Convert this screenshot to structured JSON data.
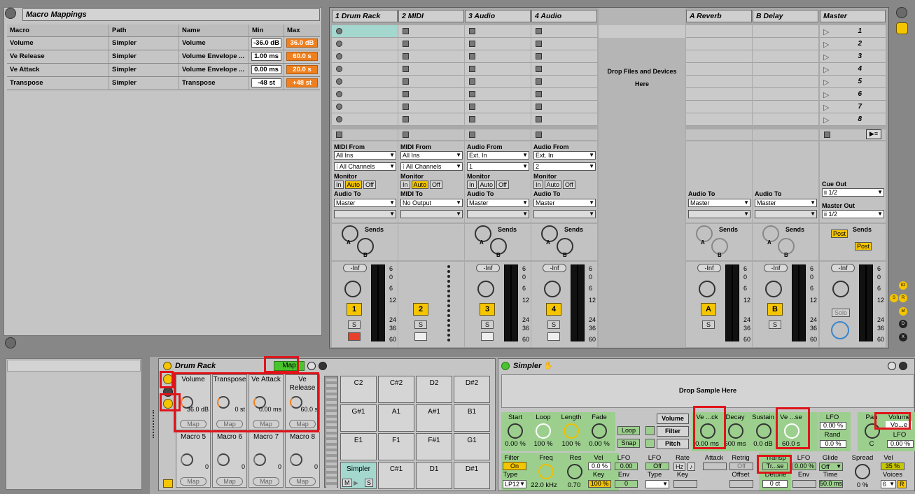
{
  "macro_mappings": {
    "title": "Macro Mappings",
    "columns": [
      "Macro",
      "Path",
      "Name",
      "Min",
      "Max"
    ],
    "rows": [
      {
        "macro": "Volume",
        "path": "Simpler",
        "name": "Volume",
        "min": "-36.0 dB",
        "max": "36.0 dB"
      },
      {
        "macro": "Ve Release",
        "path": "Simpler",
        "name": "Volume Envelope ...",
        "min": "1.00 ms",
        "max": "60.0 s"
      },
      {
        "macro": "Ve Attack",
        "path": "Simpler",
        "name": "Volume Envelope ...",
        "min": "0.00 ms",
        "max": "20.0 s"
      },
      {
        "macro": "Transpose",
        "path": "Simpler",
        "name": "Transpose",
        "min": "-48 st",
        "max": "+48 st"
      }
    ]
  },
  "tracks": [
    {
      "name": "1 Drum Rack",
      "in_label": "MIDI From",
      "in_src": "All Ins",
      "in_ch": "⁝ All Channels",
      "out_label": "Audio To",
      "out": "Master",
      "number": "1"
    },
    {
      "name": "2 MIDI",
      "in_label": "MIDI From",
      "in_src": "All Ins",
      "in_ch": "⁝ All Channels",
      "out_label": "MIDI To",
      "out": "No Output",
      "number": "2"
    },
    {
      "name": "3 Audio",
      "in_label": "Audio From",
      "in_src": "Ext. In",
      "in_ch": "1",
      "out_label": "Audio To",
      "out": "Master",
      "number": "3"
    },
    {
      "name": "4 Audio",
      "in_label": "Audio From",
      "in_src": "Ext. In",
      "in_ch": "2",
      "out_label": "Audio To",
      "out": "Master",
      "number": "4"
    }
  ],
  "returns": [
    {
      "name": "A Reverb",
      "out_label": "Audio To",
      "out": "Master",
      "letter": "A"
    },
    {
      "name": "B Delay",
      "out_label": "Audio To",
      "out": "Master",
      "letter": "B"
    }
  ],
  "master": {
    "name": "Master",
    "scenes": [
      "1",
      "2",
      "3",
      "4",
      "5",
      "6",
      "7",
      "8"
    ],
    "cue_label": "Cue Out",
    "cue": "ii 1/2",
    "out_label": "Master Out",
    "out": "ii 1/2",
    "post": "Post",
    "solo": "Solo"
  },
  "drop_files": "Drop Files and Devices Here",
  "mixer": {
    "monitor": "Monitor",
    "mon_in": "In",
    "mon_auto": "Auto",
    "mon_off": "Off",
    "sends": "Sends",
    "inf": "-Inf",
    "solo_s": "S",
    "scale": [
      "6",
      "0",
      "6",
      "12",
      "24",
      "36",
      "60"
    ],
    "knob_a": "A",
    "knob_b": "B"
  },
  "drum_rack": {
    "title": "Drum Rack",
    "map": "Map",
    "macros": [
      {
        "label": "Volume",
        "value": "36.0 dB"
      },
      {
        "label": "Transpose",
        "value": "0 st"
      },
      {
        "label": "Ve Attack",
        "value": "0.00 ms"
      },
      {
        "label": "Ve Release",
        "value": "60.0 s"
      },
      {
        "label": "Macro 5",
        "value": "0"
      },
      {
        "label": "Macro 6",
        "value": "0"
      },
      {
        "label": "Macro 7",
        "value": "0"
      },
      {
        "label": "Macro 8",
        "value": "0"
      }
    ],
    "map_label": "Map",
    "pads": [
      "C2",
      "C#2",
      "D2",
      "D#2",
      "G#1",
      "A1",
      "A#1",
      "B1",
      "E1",
      "F1",
      "F#1",
      "G1",
      "Simpler",
      "C#1",
      "D1",
      "D#1"
    ],
    "pad_m": "M",
    "pad_s": "S"
  },
  "simpler": {
    "title": "Simpler",
    "drop": "Drop Sample Here",
    "start": "Start",
    "start_v": "0.00 %",
    "loop": "Loop",
    "loop_v": "100 %",
    "length": "Length",
    "length_v": "100 %",
    "fade": "Fade",
    "fade_v": "0.00 %",
    "loop_btn": "Loop",
    "snap_btn": "Snap",
    "volume_btn": "Volume",
    "filter_btn": "Filter",
    "pitch_btn": "Pitch",
    "ve_attack": "Ve ...ck",
    "ve_attack_v": "0.00 ms",
    "decay": "Decay",
    "decay_v": "600 ms",
    "sustain": "Sustain",
    "sustain_v": "0.0 dB",
    "ve_release": "Ve ...se",
    "ve_release_v": "60.0 s",
    "lfo": "LFO",
    "lfo_v": "0.00 %",
    "rand": "Rand",
    "rand_v": "0.0 %",
    "pan": "Pan",
    "pan_v": "C",
    "volume": "Volume",
    "volume_v": "Vo...e",
    "volume_lfo": "LFO",
    "volume_lfo_v": "0.00 %",
    "filter": "Filter",
    "filter_on": "On",
    "freq": "Freq",
    "freq_v": "22.0 kHz",
    "res": "Res",
    "res_v": "0.70",
    "vel": "Vel",
    "vel_v": "0.0 %",
    "flfo": "LFO",
    "flfo_v": "0.00",
    "type": "Type",
    "type_v": "LP12",
    "key": "Key",
    "key_v": "100 %",
    "env": "Env",
    "env_v": "0",
    "lfo2": "LFO",
    "lfo2_v": "Off",
    "rate": "Rate",
    "hz": "Hz",
    "note": "♪",
    "attack": "Attack",
    "retrig": "Retrig",
    "retrig_v": "Off",
    "type2": "Type",
    "key2": "Key",
    "offset": "Offset",
    "transp": "Transp",
    "transp_v": "Tr...se",
    "plfo": "LFO",
    "plfo_v": "0.00 %",
    "glide": "Glide",
    "glide_v": "Off",
    "spread": "Spread",
    "spread_v": "0 %",
    "vel2": "Vel",
    "vel2_v": "35 %",
    "detune": "Detune",
    "detune_v": "0 ct",
    "penv": "Env",
    "time": "Time",
    "time_v": "50.0 ms",
    "voices": "Voices",
    "voices_v": "6",
    "r": "R"
  },
  "side_indicators": [
    "IO",
    "S",
    "R",
    "M",
    "D",
    "X"
  ]
}
